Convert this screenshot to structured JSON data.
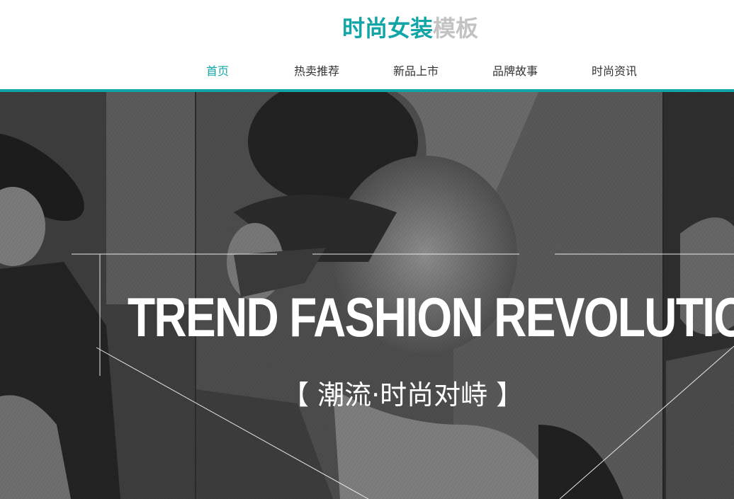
{
  "header": {
    "logo_main": "时尚女装",
    "logo_sub": "模板"
  },
  "nav": {
    "items": [
      {
        "label": "首页",
        "active": true
      },
      {
        "label": "热卖推荐",
        "active": false
      },
      {
        "label": "新品上市",
        "active": false
      },
      {
        "label": "品牌故事",
        "active": false
      },
      {
        "label": "时尚资讯",
        "active": false
      }
    ]
  },
  "hero": {
    "headline": "TREND FASHION REVOLUTION",
    "subtitle": "【 潮流·时尚对峙 】"
  },
  "colors": {
    "accent": "#12a5a8",
    "logo_sub": "#c3c3c3",
    "nav_text": "#333333",
    "hero_bg": "#4a4a4a"
  }
}
